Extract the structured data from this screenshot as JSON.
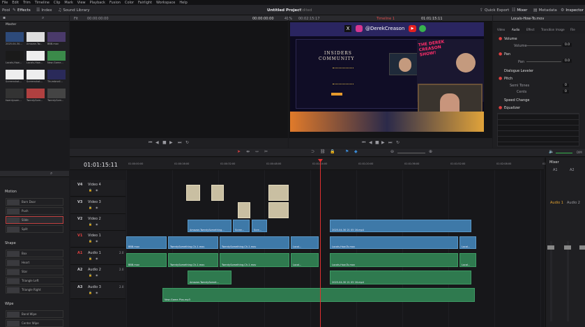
{
  "menu": [
    "File",
    "Edit",
    "Trim",
    "Timeline",
    "Clip",
    "Mark",
    "View",
    "Playback",
    "Fusion",
    "Color",
    "Fairlight",
    "Workspace",
    "Help"
  ],
  "toolbar": {
    "pool": "Pool",
    "effects": "Effects",
    "index": "Index",
    "sound_library": "Sound Library",
    "project_title": "Untitled Project",
    "edited": "Edited",
    "quick_export": "Quick Export",
    "mixer": "Mixer",
    "metadata": "Metadata",
    "inspector": "Inspector"
  },
  "source": {
    "timecode_left": "00:00:00:00",
    "zoom": "Fit",
    "timecode_right": "00:00:00:00"
  },
  "viewer": {
    "zoom": "41%",
    "duration": "00:02:15:17",
    "timeline_name": "Timeline 1",
    "timecode": "01:01:15:11"
  },
  "media_pool": {
    "bin": "Master",
    "clips": [
      "2025-04-30...",
      "Amazon-Tw...",
      "BBB.mov",
      "Locals-How...",
      "Locals-How...",
      "New-Game...",
      "Screenshot...",
      "Screenshot...",
      "Thumbnail...",
      "twentysom...",
      "TwentySom...",
      "TwentySom..."
    ]
  },
  "inspector": {
    "clip": "Locals-How-To.mov",
    "tabs": [
      "Video",
      "Audio",
      "Effect",
      "Transition",
      "Image",
      "File"
    ],
    "active_tab": "Audio",
    "volume_label": "Volume",
    "volume_sub": "Volume",
    "volume_val": "0.0",
    "pan_label": "Pan",
    "pan_sub": "Pan",
    "pan_val": "0.0",
    "dialogue": "Dialogue Leveler",
    "pitch": "Pitch",
    "semitones": "Semi Tones",
    "semitones_val": "0",
    "cents": "Cents",
    "cents_val": "0",
    "speed": "Speed Change",
    "equalizer": "Equalizer"
  },
  "effects": {
    "motion_title": "Motion",
    "motion": [
      "Barn Door",
      "Push",
      "Slide",
      "Split"
    ],
    "selected": "Slide",
    "shape_title": "Shape",
    "shape": [
      "Box",
      "Heart",
      "Star",
      "Triangle Left",
      "Triangle Right"
    ],
    "wipe_title": "Wipe",
    "wipe": [
      "Band Wipe",
      "Center Wipe"
    ]
  },
  "timeline": {
    "timecode": "01:01:15:11",
    "ruler": [
      "01:00:00:00",
      "01:00:16:00",
      "01:00:32:00",
      "01:00:48:00",
      "01:01:04:00",
      "01:01:20:00",
      "01:01:36:00",
      "01:01:52:00",
      "01:02:08:00",
      "01:02:24:00"
    ],
    "tracks": [
      {
        "id": "V4",
        "name": "Video 4"
      },
      {
        "id": "V3",
        "name": "Video 3"
      },
      {
        "id": "V2",
        "name": "Video 2"
      },
      {
        "id": "V1",
        "name": "Video 1"
      },
      {
        "id": "A1",
        "name": "Audio 1",
        "ch": "2.0"
      },
      {
        "id": "A2",
        "name": "Audio 2",
        "ch": "2.0"
      },
      {
        "id": "A3",
        "name": "Audio 3",
        "ch": "2.0"
      }
    ],
    "clips": {
      "v2a": "Amazon-TwentySomething...",
      "v2b": "Scree...",
      "v2c": "Scre...",
      "v2d": "2025-04-30 21 05 16.mp4",
      "v1a": "BBB.mov",
      "v1b": "TwentySomething-Ch-1.mov",
      "v1c": "TwentySomething-Ch-1.mov",
      "v1d": "Local...",
      "v1e": "Locals-How-To.mov",
      "v1f": "Local...",
      "a1a": "BBB.mov",
      "a1b": "TwentySomething-Ch-1.mov",
      "a1c": "TwentySomething-Ch-1.mov",
      "a1d": "Local...",
      "a1e": "Locals-How-To.mov",
      "a1f": "Local...",
      "a2a": "Amazon-TwentySomet...",
      "a2b": "2025-04-30 21 05 16.mp4",
      "a3": "New-Game-Plus.mp3"
    }
  },
  "mixer": {
    "title": "Mixer",
    "ch": [
      "A1",
      "A2"
    ],
    "bus": [
      "Audio 1",
      "Audio 2"
    ],
    "dim": "DIM"
  },
  "youtube_preview": {
    "handle": "@DerekCreason",
    "title1": "INSIDERS",
    "title2": "COMMUNITY",
    "show": "THE DEREK CREASON SHOW!"
  }
}
